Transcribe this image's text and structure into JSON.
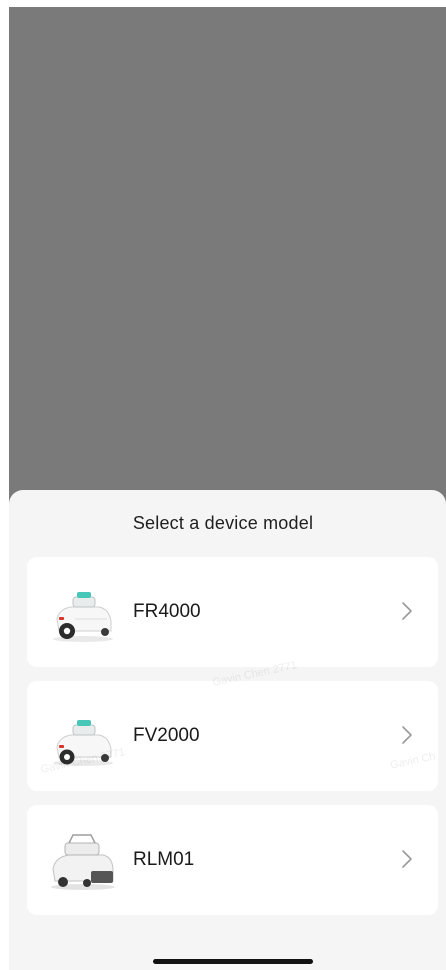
{
  "sheet": {
    "title": "Select a device model"
  },
  "devices": [
    {
      "name": "FR4000",
      "icon": "robot-mower-icon",
      "chevron_icon": "chevron-right-icon"
    },
    {
      "name": "FV2000",
      "icon": "robot-mower-icon",
      "chevron_icon": "chevron-right-icon"
    },
    {
      "name": "RLM01",
      "icon": "robot-mower-icon",
      "chevron_icon": "chevron-right-icon"
    }
  ],
  "watermark": {
    "text_1": "Gavin Chen 2771",
    "text_2": "Gavin Chen 2771",
    "text_3": "Gavin Ch"
  },
  "colors": {
    "overlay": "#7a7a7a",
    "sheet_bg": "#f5f5f5",
    "card_bg": "#ffffff",
    "accent_teal": "#46c7b8",
    "accent_red": "#d9342b"
  }
}
